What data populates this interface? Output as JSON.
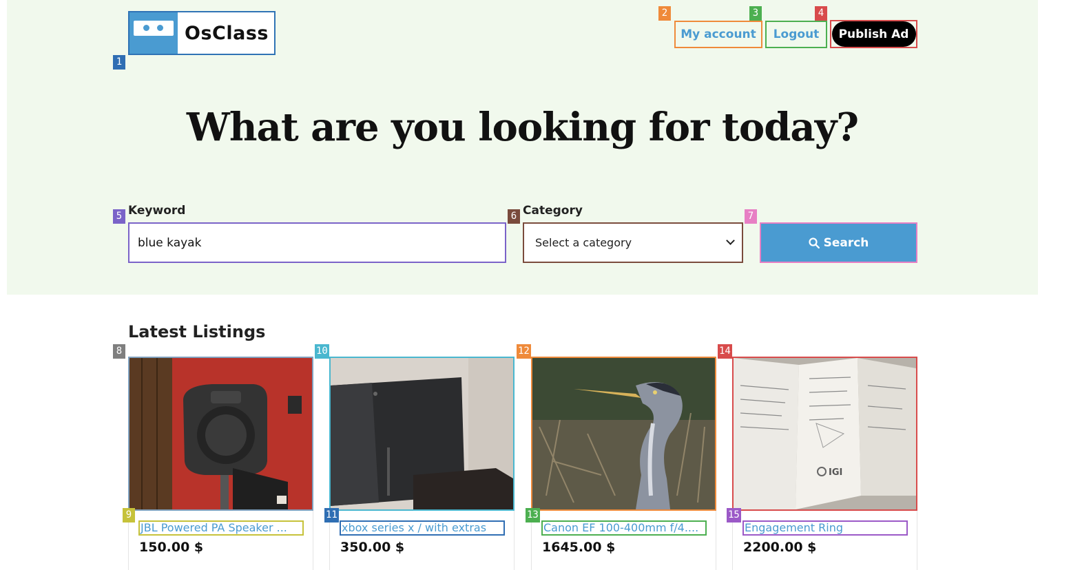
{
  "header": {
    "logo_text": "OsClass",
    "nav": {
      "my_account": "My account",
      "logout": "Logout",
      "publish_ad": "Publish Ad"
    }
  },
  "hero": {
    "headline": "What are you looking for today?",
    "keyword": {
      "label": "Keyword",
      "value": "blue kayak"
    },
    "category": {
      "label": "Category",
      "selected": "Select a category"
    },
    "search_button": "Search"
  },
  "listings": {
    "heading": "Latest Listings",
    "items": [
      {
        "title": "JBL Powered PA Speaker ...",
        "price": "150.00 $",
        "image": "speaker-photo"
      },
      {
        "title": "xbox series x / with extras",
        "price": "350.00 $",
        "image": "console-photo"
      },
      {
        "title": "Canon EF 100-400mm f/4....",
        "price": "1645.00 $",
        "image": "heron-photo"
      },
      {
        "title": "Engagement Ring",
        "price": "2200.00 $",
        "image": "certificate-photo"
      }
    ]
  },
  "annotation_tags": [
    "1",
    "2",
    "3",
    "4",
    "5",
    "6",
    "7",
    "8",
    "9",
    "10",
    "11",
    "12",
    "13",
    "14",
    "15"
  ],
  "colors": {
    "hero_bg": "#f1f9ed",
    "accent": "#4a9bd1",
    "publish_bg": "#000000"
  }
}
